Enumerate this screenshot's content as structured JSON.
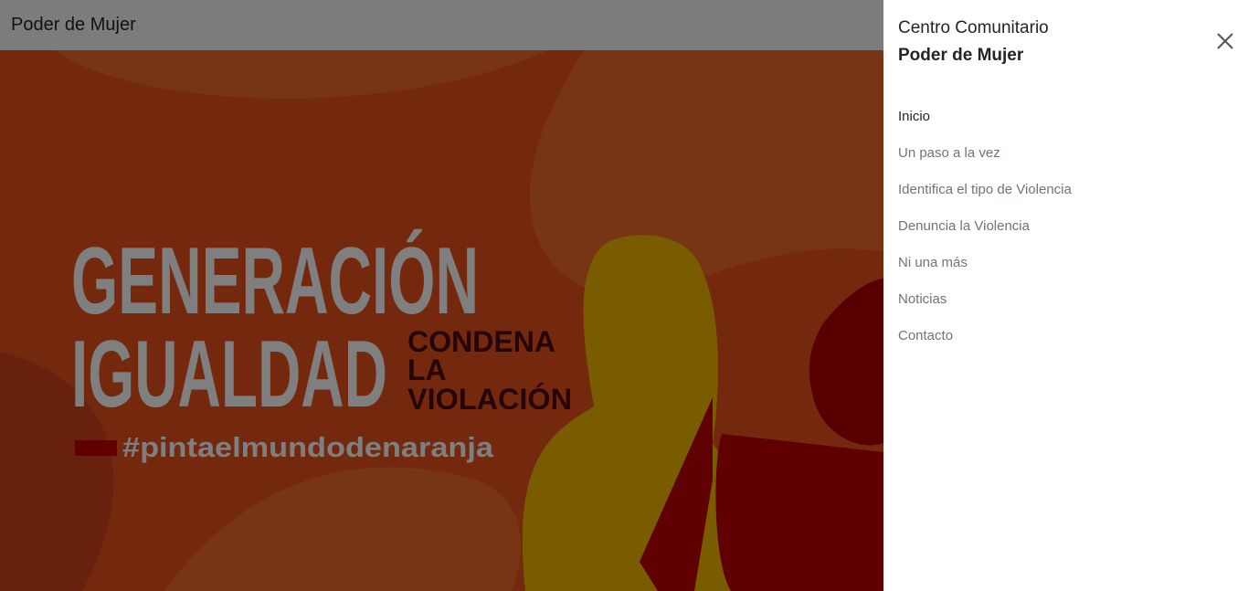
{
  "navbar": {
    "brand": "Poder de Mujer"
  },
  "hero": {
    "headline_1": "GENERACIÓN",
    "headline_2": "IGUALDAD",
    "sub_1": "CONDENA",
    "sub_2": "LA",
    "sub_3": "VIOLACIÓN",
    "hashtag": "#pintaelmundodenaranja",
    "colors": {
      "background": "#e8531c",
      "shape_light": "#f06a2a",
      "shape_dark": "#d1431a",
      "headline": "#ffffff",
      "sub": "#4a0a0a",
      "figure_yellow": "#f5b800",
      "figure_red": "#c00000"
    }
  },
  "offcanvas": {
    "title_line_1": "Centro Comunitario",
    "title_line_2": "Poder de Mujer",
    "close_icon": "close-icon",
    "nav": [
      {
        "label": "Inicio",
        "active": true
      },
      {
        "label": "Un paso a la vez",
        "active": false
      },
      {
        "label": "Identifica el tipo de Violencia",
        "active": false
      },
      {
        "label": "Denuncia la Violencia",
        "active": false
      },
      {
        "label": "Ni una más",
        "active": false
      },
      {
        "label": "Noticias",
        "active": false
      },
      {
        "label": "Contacto",
        "active": false
      }
    ]
  }
}
